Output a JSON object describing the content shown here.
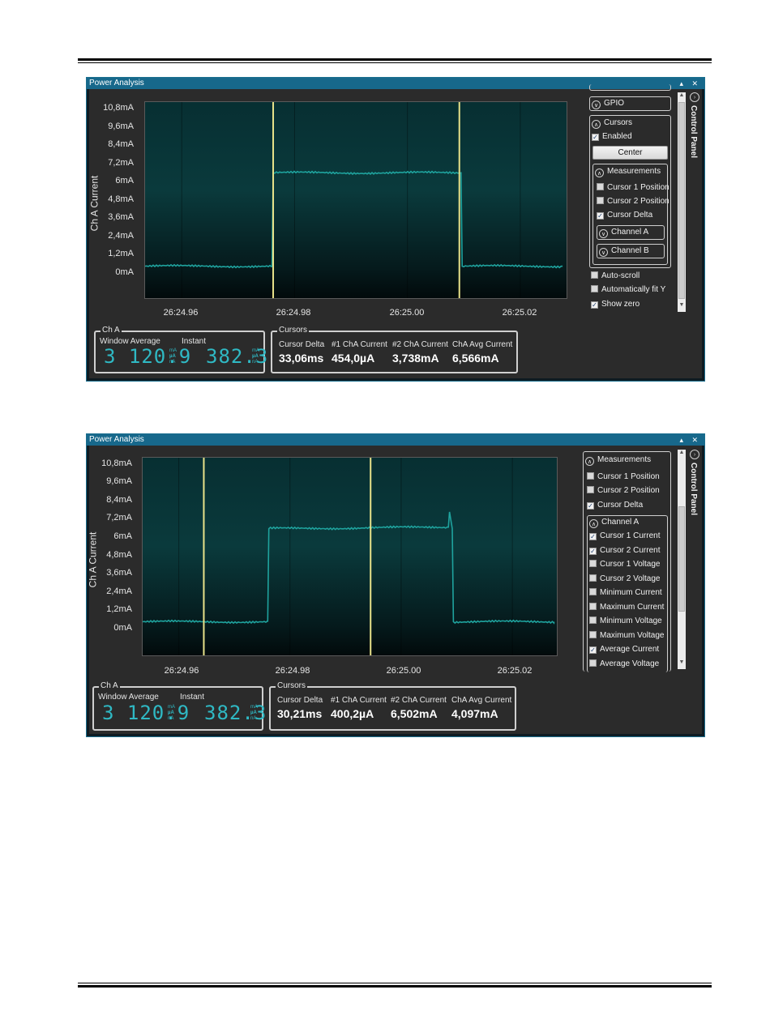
{
  "title": "Power Analysis",
  "title_controls": "▴ ✕",
  "colors": {
    "trace": "#1fa39e",
    "cursor": "#e8e28a",
    "accent": "#17688b"
  },
  "control_panel_label": "Control Panel",
  "screens": [
    {
      "chart_data": {
        "type": "line",
        "ylabel": "Ch A Current",
        "y_ticks": [
          "10,8mA",
          "9,6mA",
          "8,4mA",
          "7,2mA",
          "6mA",
          "4,8mA",
          "3,6mA",
          "2,4mA",
          "1,2mA",
          "0mA"
        ],
        "x_ticks": [
          "26:24.96",
          "26:24.98",
          "26:25.00",
          "26:25.02"
        ],
        "ylim_mA": [
          0,
          10.8
        ],
        "series": [
          {
            "x_s": [
              26.9535,
              26.976,
              26.9762,
              27.0095,
              27.0097,
              27.0275
            ],
            "y_mA": [
              0.45,
              0.45,
              6.6,
              6.6,
              0.45,
              0.45
            ]
          }
        ],
        "cursors_s": [
          26.9762,
          27.0092
        ]
      },
      "cha": {
        "legend": "Ch A",
        "window_average_label": "Window Average",
        "instant_label": "Instant",
        "window_average_display": "3 120.9",
        "instant_display": "382.3",
        "units": [
          "mA",
          "µA",
          "nA"
        ]
      },
      "cursors": {
        "legend": "Cursors",
        "cols": [
          {
            "label": "Cursor Delta",
            "value": "33,06ms"
          },
          {
            "label": "#1 ChA Current",
            "value": "454,0µA"
          },
          {
            "label": "#2 ChA Current",
            "value": "3,738mA"
          },
          {
            "label": "ChA Avg Current",
            "value": "6,566mA"
          }
        ]
      },
      "panel": {
        "gpio": "GPIO",
        "cursors_group": "Cursors",
        "enabled": "Enabled",
        "center": "Center",
        "measurements": "Measurements",
        "cursor1_position": "Cursor 1 Position",
        "cursor2_position": "Cursor 2 Position",
        "cursor_delta": "Cursor Delta",
        "channel_a": "Channel A",
        "channel_b": "Channel B",
        "auto_scroll": "Auto-scroll",
        "auto_fit_y": "Automatically fit Y",
        "show_zero": "Show zero"
      }
    },
    {
      "chart_data": {
        "type": "line",
        "ylabel": "Ch A Current",
        "y_ticks": [
          "10,8mA",
          "9,6mA",
          "8,4mA",
          "7,2mA",
          "6mA",
          "4,8mA",
          "3,6mA",
          "2,4mA",
          "1,2mA",
          "0mA"
        ],
        "x_ticks": [
          "26:24.96",
          "26:24.98",
          "26:25.00",
          "26:25.02"
        ],
        "ylim_mA": [
          0,
          10.8
        ],
        "series": [
          {
            "x_s": [
              26.9535,
              26.976,
              26.9762,
              27.0085,
              27.0087,
              27.0092,
              27.0094,
              27.0275
            ],
            "y_mA": [
              0.4,
              0.4,
              6.5,
              6.6,
              7.6,
              6.5,
              0.4,
              0.4
            ]
          }
        ],
        "cursors_s": [
          26.9645,
          26.9945
        ]
      },
      "cha": {
        "legend": "Ch A",
        "window_average_label": "Window Average",
        "instant_label": "Instant",
        "window_average_display": "3 120.9",
        "instant_display": "382.3",
        "units": [
          "mA",
          "µA",
          "nA"
        ]
      },
      "cursors": {
        "legend": "Cursors",
        "cols": [
          {
            "label": "Cursor Delta",
            "value": "30,21ms"
          },
          {
            "label": "#1 ChA Current",
            "value": "400,2µA"
          },
          {
            "label": "#2 ChA Current",
            "value": "6,502mA"
          },
          {
            "label": "ChA Avg Current",
            "value": "4,097mA"
          }
        ]
      },
      "panel": {
        "measurements": "Measurements",
        "cursor1_position": "Cursor 1 Position",
        "cursor2_position": "Cursor 2 Position",
        "cursor_delta": "Cursor Delta",
        "channel_a": "Channel A",
        "cursor1_current": "Cursor 1 Current",
        "cursor2_current": "Cursor 2 Current",
        "cursor1_voltage": "Cursor 1 Voltage",
        "cursor2_voltage": "Cursor 2 Voltage",
        "min_current": "Minimum Current",
        "max_current": "Maximum Current",
        "min_voltage": "Minimum Voltage",
        "max_voltage": "Maximum Voltage",
        "avg_current": "Average Current",
        "avg_voltage": "Average Voltage"
      }
    }
  ]
}
